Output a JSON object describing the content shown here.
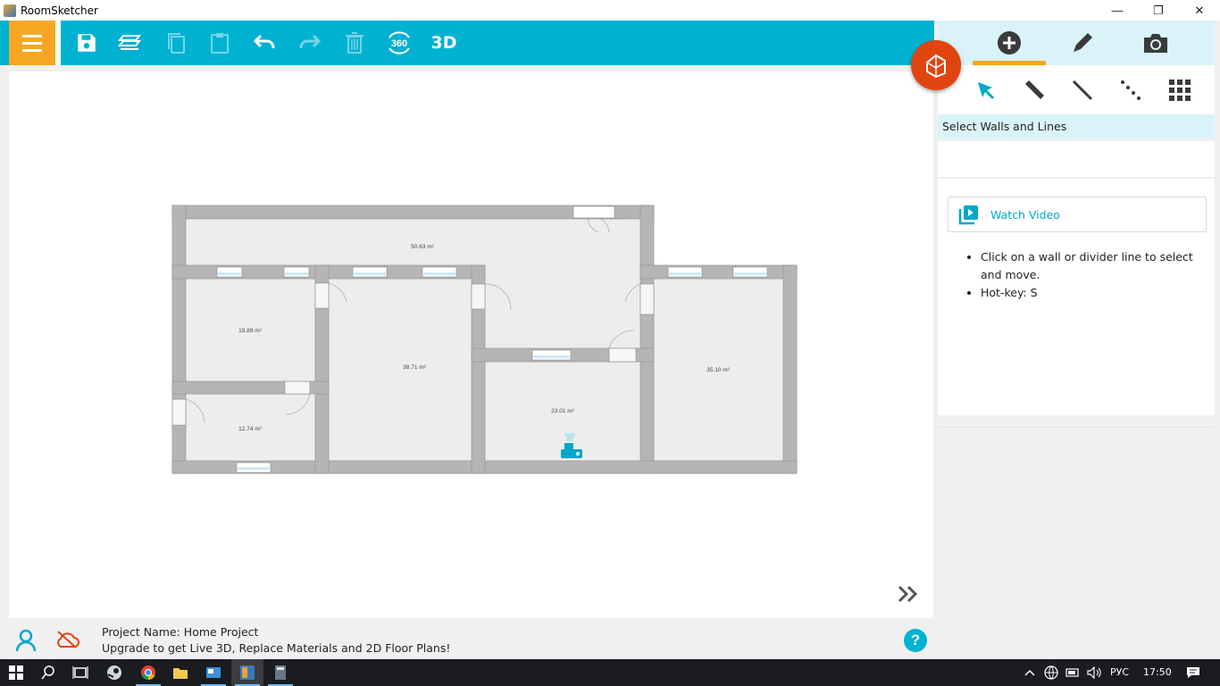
{
  "window": {
    "title": "RoomSketcher",
    "minimize": "—",
    "restore": "❐",
    "close": "✕"
  },
  "toolbar": {
    "menu_icon": "hamburger-menu-icon",
    "tools": [
      "save-icon",
      "layers-icon",
      "copy-icon",
      "paste-icon",
      "undo-icon",
      "redo-icon",
      "delete-icon",
      "360-view-icon"
    ],
    "view_3d_label": "3D",
    "view_360_label": "360",
    "accent_color": "#00b2d2",
    "menu_color": "#f6a623"
  },
  "floorplan": {
    "rooms": [
      {
        "area": "50.63 m²"
      },
      {
        "area": "19.89 m²"
      },
      {
        "area": "38.71 m²"
      },
      {
        "area": "35.10 m²"
      },
      {
        "area": "23.01 m²"
      },
      {
        "area": "12.74 m²"
      }
    ]
  },
  "right_panel": {
    "tabs": [
      "add-icon",
      "edit-pencil-icon",
      "camera-icon"
    ],
    "active_tab": 0,
    "tools": [
      "select-arrow-icon",
      "wall-tool-icon",
      "line-tool-icon",
      "dotted-line-tool-icon",
      "grid-tool-icon"
    ],
    "heading": "Select Walls and Lines",
    "watch_video_label": "Watch Video",
    "tips": [
      "Click on a wall or divider line to select and move.",
      "Hot-key: S"
    ]
  },
  "footer": {
    "project_name": "Project Name: Home Project",
    "upgrade_text": "Upgrade to get Live 3D, Replace Materials and 2D Floor Plans!",
    "help_label": "?"
  },
  "taskbar": {
    "language": "РУС",
    "time": "17:50"
  }
}
